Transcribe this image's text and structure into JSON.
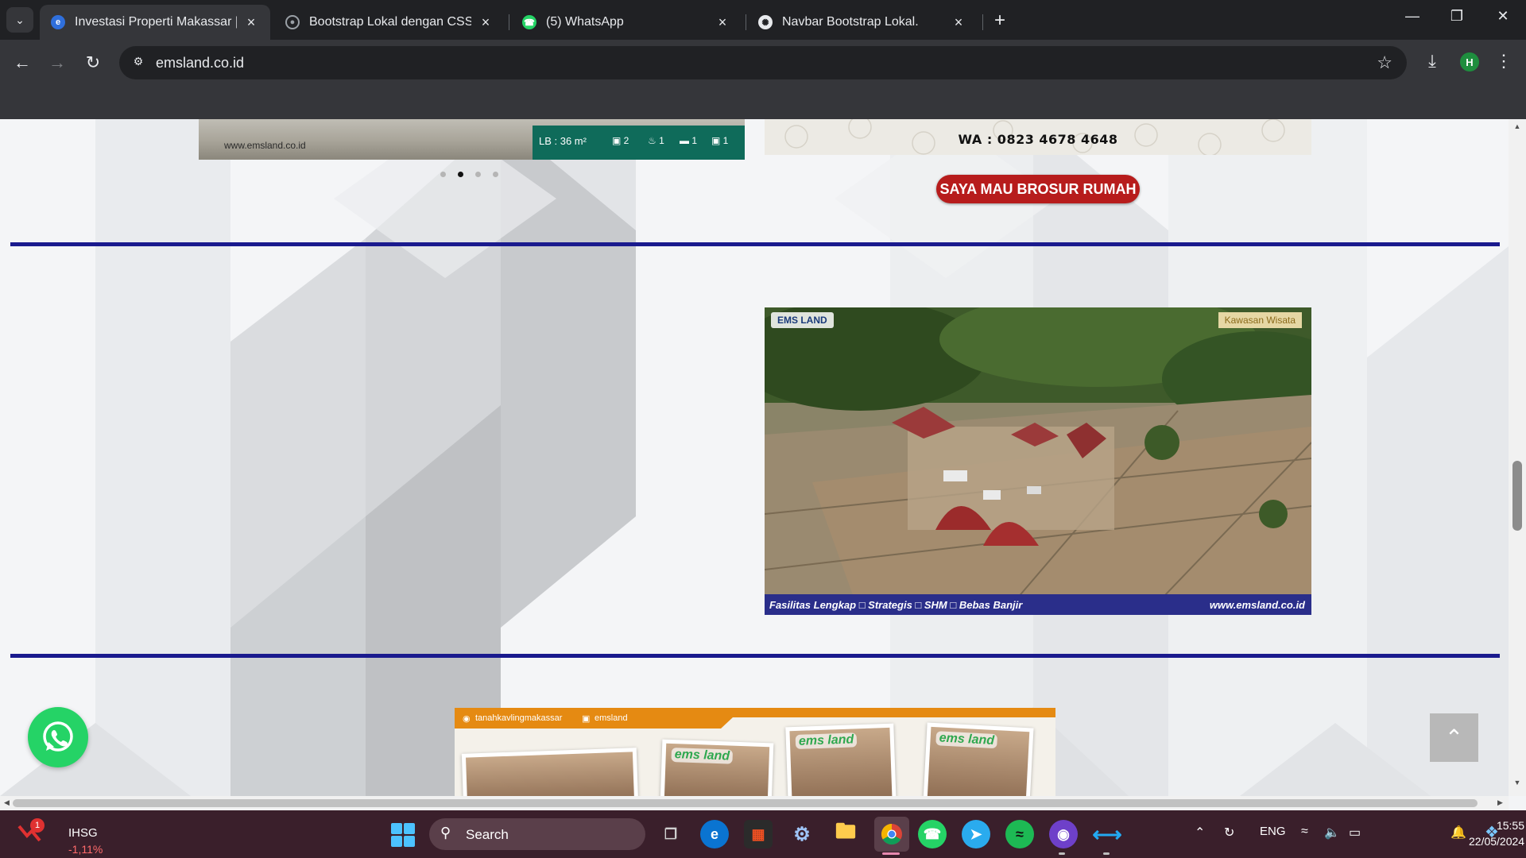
{
  "tabs": [
    {
      "title": "Investasi Properti Makassar | EM",
      "active": true
    },
    {
      "title": "Bootstrap Lokal dengan CSS da",
      "active": false
    },
    {
      "title": "(5) WhatsApp",
      "active": false
    },
    {
      "title": "Navbar Bootstrap Lokal.",
      "active": false
    }
  ],
  "toolbar": {
    "url": "emsland.co.id",
    "profile_initial": "H"
  },
  "page": {
    "banner": {
      "watermark": "www.emsland.co.id",
      "spec_lb": "LB : 36 m²",
      "icons": [
        "2",
        "1",
        "1",
        "1"
      ]
    },
    "carousel": {
      "count": 4,
      "active_index": 1
    },
    "wa_number": "WA : 0823 4678 4648",
    "cta_label": "SAYA MAU BROSUR RUMAH",
    "video": {
      "logo": "EMS LAND",
      "tag": "Kawasan Wisata",
      "caption_left": "Fasilitas Lengkap □ Strategis □ SHM □ Bebas Banjir",
      "caption_right": "www.emsland.co.id"
    },
    "social": {
      "instagram": "tanahkavlingmakassar",
      "facebook": "emsland",
      "photo_brands": [
        "ems land",
        "ems land",
        "ems land"
      ]
    }
  },
  "taskbar": {
    "stock_name": "IHSG",
    "stock_change": "-1,11%",
    "stock_badge": "1",
    "search_label": "Search",
    "lang": "ENG",
    "time": "15:55",
    "date": "22/05/2024"
  },
  "colors": {
    "divider": "#1a1a8e",
    "cta": "#b71c1c",
    "whatsapp": "#25d366",
    "taskbar": "#3a1f2b"
  }
}
